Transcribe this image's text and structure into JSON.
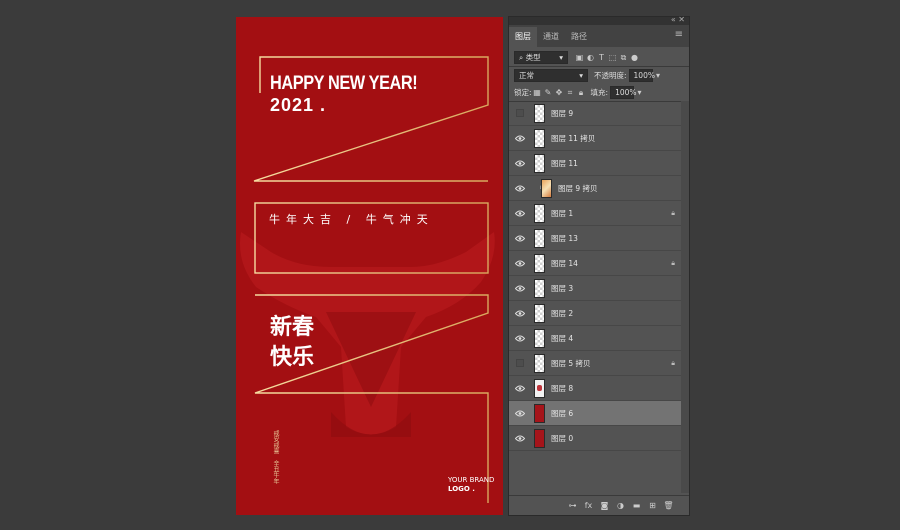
{
  "poster": {
    "headline": "HAPPY NEW YEAR!",
    "year": "2021 .",
    "slogan": "牛年大吉 / 牛气冲天",
    "greeting_line1": "新春",
    "greeting_line2": "快乐",
    "vertical_text1": "戒安戒喜",
    "vertical_text2": "辛丑牛年",
    "brand": "YOUR BRAND",
    "logo": "LOGO ."
  },
  "panel": {
    "tabs": [
      {
        "label": "图层"
      },
      {
        "label": "通道"
      },
      {
        "label": "路径"
      }
    ],
    "filter_kind": "类型",
    "blend_mode": "正常",
    "opacity_label": "不透明度:",
    "opacity_value": "100%",
    "lock_label": "锁定:",
    "fill_label": "填充:",
    "fill_value": "100%",
    "layers": [
      {
        "name": "图层 9",
        "visible": false,
        "thumb": "checker",
        "locked": false
      },
      {
        "name": "图层 11 拷贝",
        "visible": true,
        "thumb": "checker",
        "locked": false
      },
      {
        "name": "图层 11",
        "visible": true,
        "thumb": "checker",
        "locked": false
      },
      {
        "name": "图层 9 拷贝",
        "visible": true,
        "thumb": "orange",
        "locked": false,
        "clipped": true
      },
      {
        "name": "图层 1",
        "visible": true,
        "thumb": "checker",
        "locked": true
      },
      {
        "name": "图层 13",
        "visible": true,
        "thumb": "checker",
        "locked": false
      },
      {
        "name": "图层 14",
        "visible": true,
        "thumb": "checker",
        "locked": true
      },
      {
        "name": "图层 3",
        "visible": true,
        "thumb": "checker",
        "locked": false
      },
      {
        "name": "图层 2",
        "visible": true,
        "thumb": "checker",
        "locked": false
      },
      {
        "name": "图层 4",
        "visible": true,
        "thumb": "checker",
        "locked": false
      },
      {
        "name": "图层 5 拷贝",
        "visible": false,
        "thumb": "checker",
        "locked": true
      },
      {
        "name": "图层 8",
        "visible": true,
        "thumb": "bull",
        "locked": false
      },
      {
        "name": "图层 6",
        "visible": true,
        "thumb": "red",
        "locked": false,
        "selected": true
      },
      {
        "name": "图层 0",
        "visible": true,
        "thumb": "red",
        "locked": false
      }
    ]
  },
  "colors": {
    "poster_red": "#a30f12",
    "gold_line": "#e8c27a",
    "panel_bg": "#535353",
    "selected_row": "#737373"
  }
}
